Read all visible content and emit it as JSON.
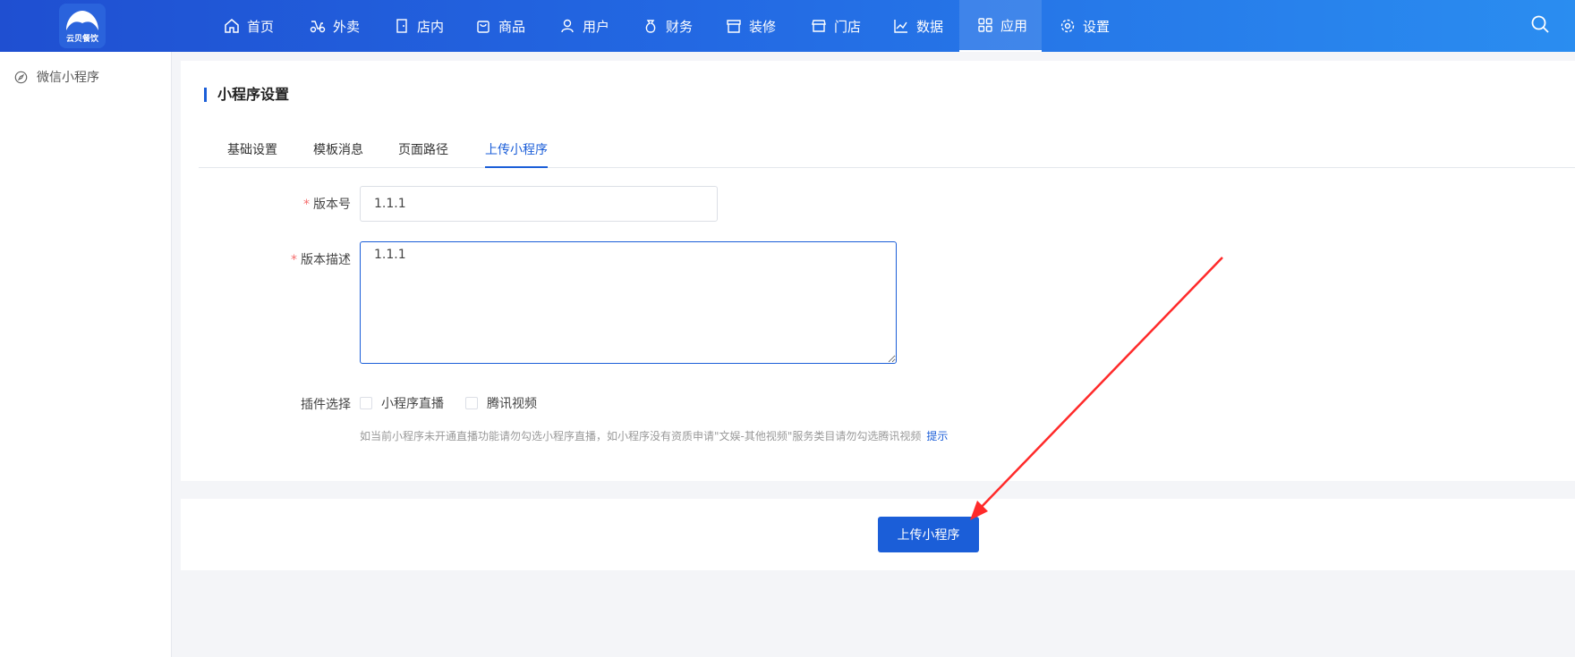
{
  "brand": {
    "logo_text": "云贝餐饮"
  },
  "nav": {
    "items": [
      {
        "label": "首页",
        "icon": "home-icon"
      },
      {
        "label": "外卖",
        "icon": "scooter-icon"
      },
      {
        "label": "店内",
        "icon": "door-icon"
      },
      {
        "label": "商品",
        "icon": "bag-icon"
      },
      {
        "label": "用户",
        "icon": "user-icon"
      },
      {
        "label": "财务",
        "icon": "moneybag-icon"
      },
      {
        "label": "装修",
        "icon": "shop-icon"
      },
      {
        "label": "门店",
        "icon": "store-icon"
      },
      {
        "label": "数据",
        "icon": "chart-icon"
      },
      {
        "label": "应用",
        "icon": "apps-icon"
      },
      {
        "label": "设置",
        "icon": "gear-icon"
      }
    ],
    "active": "应用"
  },
  "sidebar": {
    "items": [
      {
        "label": "微信小程序",
        "icon": "compass-icon"
      }
    ]
  },
  "panel": {
    "title": "小程序设置",
    "tabs": [
      {
        "label": "基础设置"
      },
      {
        "label": "模板消息"
      },
      {
        "label": "页面路径"
      },
      {
        "label": "上传小程序"
      }
    ],
    "active_tab": "上传小程序"
  },
  "form": {
    "required_mark": "*",
    "version_label": "版本号",
    "version_value": "1.1.1",
    "desc_label": "版本描述",
    "desc_value": "1.1.1",
    "plugin_label": "插件选择",
    "plugins": [
      {
        "label": "小程序直播",
        "checked": false
      },
      {
        "label": "腾讯视频",
        "checked": false
      }
    ],
    "hint": "如当前小程序未开通直播功能请勿勾选小程序直播，如小程序没有资质申请\"文娱-其他视频\"服务类目请勿勾选腾讯视频",
    "hint_link": "提示"
  },
  "footer": {
    "upload_button": "上传小程序"
  },
  "colors": {
    "primary": "#1b5ed8",
    "nav_start": "#1f4fd1",
    "nav_end": "#2a8df0",
    "annotation": "#ff2a2a"
  }
}
